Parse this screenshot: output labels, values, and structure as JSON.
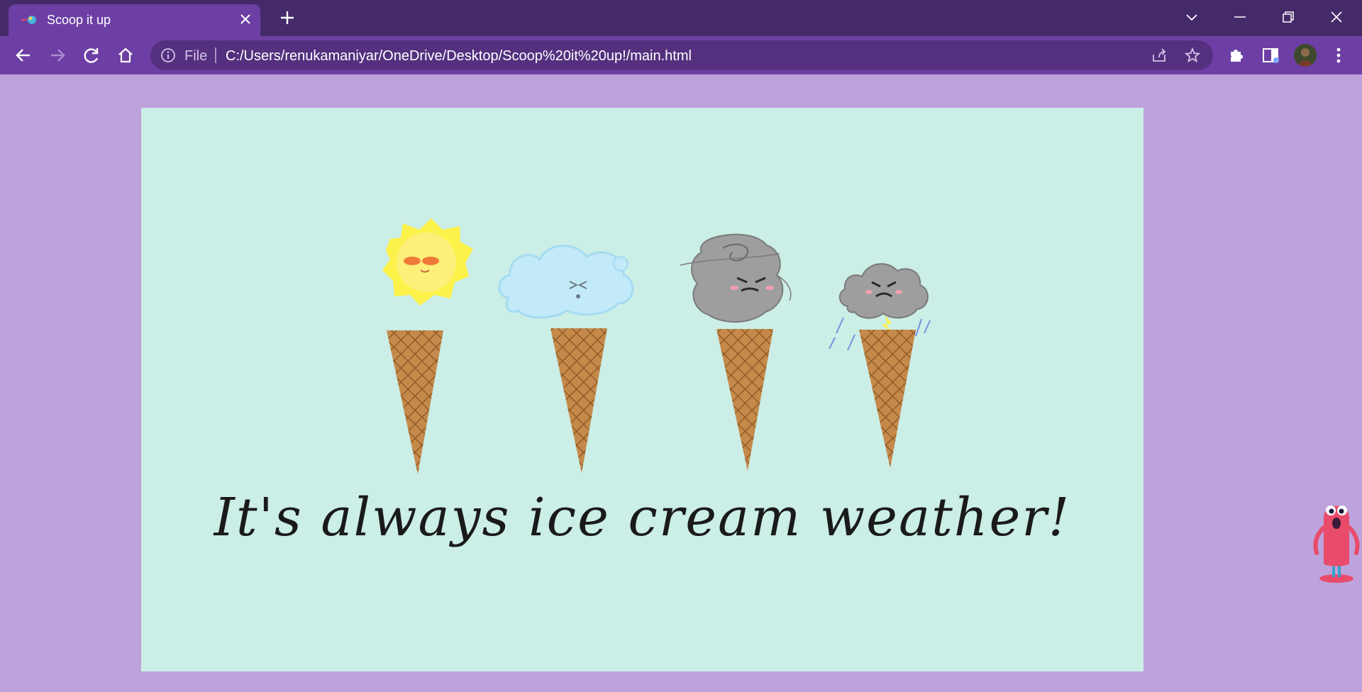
{
  "browser": {
    "tab_title": "Scoop it up",
    "address_scheme": "File",
    "address_url": "C:/Users/renukamaniyar/OneDrive/Desktop/Scoop%20it%20up!/main.html"
  },
  "page": {
    "headline": "It's always ice cream weather!",
    "illustrations": [
      "sun-cone",
      "cloud-cone",
      "tornado-cone",
      "storm-cone"
    ]
  },
  "colors": {
    "tab_bar": "#452a6a",
    "toolbar": "#6d3fa4",
    "page_background": "#bea2dc",
    "poster_background": "#cbeee6"
  }
}
